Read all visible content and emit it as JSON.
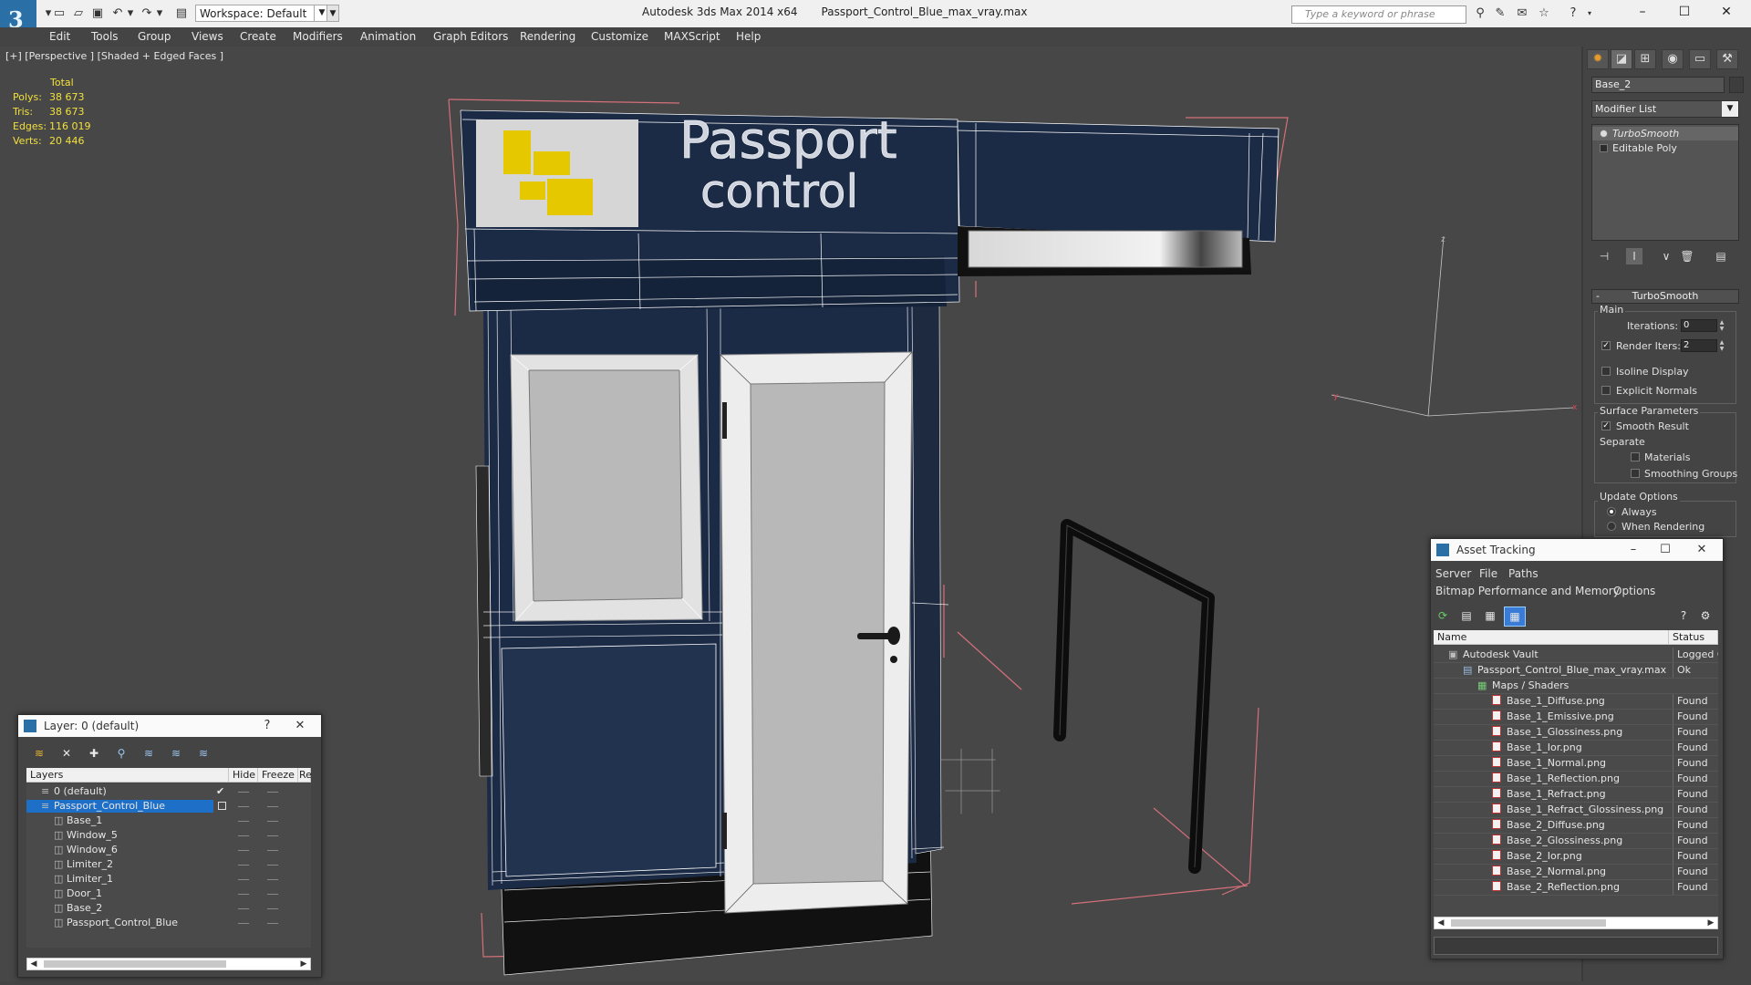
{
  "app": {
    "title": "Autodesk 3ds Max 2014 x64",
    "filename": "Passport_Control_Blue_max_vray.max",
    "workspace_label": "Workspace: Default",
    "search_placeholder": "Type a keyword or phrase"
  },
  "menus": [
    "Edit",
    "Tools",
    "Group",
    "Views",
    "Create",
    "Modifiers",
    "Animation",
    "Graph Editors",
    "Rendering",
    "Customize",
    "MAXScript",
    "Help"
  ],
  "viewport": {
    "label": "[+] [Perspective ] [Shaded + Edged Faces ]",
    "stats_header": "Total",
    "stats": [
      {
        "label": "Polys:",
        "value": "38 673"
      },
      {
        "label": "Tris:",
        "value": "38 673"
      },
      {
        "label": "Edges:",
        "value": "116 019"
      },
      {
        "label": "Verts:",
        "value": "20 446"
      }
    ],
    "sign_line1": "Passport",
    "sign_line2": "control",
    "axis_z": "z",
    "axis_y": "y",
    "axis_x": "x"
  },
  "command_panel": {
    "object_name": "Base_2",
    "modifier_list": "Modifier List",
    "stack": [
      "TurboSmooth",
      "Editable Poly"
    ],
    "rollout_title": "TurboSmooth",
    "main_group": "Main",
    "iterations_label": "Iterations:",
    "iterations_value": "0",
    "render_iters_label": "Render Iters:",
    "render_iters_value": "2",
    "isoline_label": "Isoline Display",
    "explicit_normals_label": "Explicit Normals",
    "surface_group": "Surface Parameters",
    "smooth_result_label": "Smooth Result",
    "separate_label": "Separate",
    "materials_label": "Materials",
    "smoothing_groups_label": "Smoothing Groups",
    "update_group": "Update Options",
    "always_label": "Always",
    "when_rendering_label": "When Rendering"
  },
  "layer_window": {
    "title": "Layer: 0 (default)",
    "help": "?",
    "columns": [
      "Layers",
      "Hide",
      "Freeze",
      "Re"
    ],
    "rows": [
      {
        "name": "0 (default)",
        "level": 0,
        "selected": false,
        "icon": "layer"
      },
      {
        "name": "Passport_Control_Blue",
        "level": 0,
        "selected": true,
        "icon": "layer"
      },
      {
        "name": "Base_1",
        "level": 1,
        "selected": false,
        "icon": "object"
      },
      {
        "name": "Window_5",
        "level": 1,
        "selected": false,
        "icon": "object"
      },
      {
        "name": "Window_6",
        "level": 1,
        "selected": false,
        "icon": "object"
      },
      {
        "name": "Limiter_2",
        "level": 1,
        "selected": false,
        "icon": "object"
      },
      {
        "name": "Limiter_1",
        "level": 1,
        "selected": false,
        "icon": "object"
      },
      {
        "name": "Door_1",
        "level": 1,
        "selected": false,
        "icon": "object"
      },
      {
        "name": "Base_2",
        "level": 1,
        "selected": false,
        "icon": "object"
      },
      {
        "name": "Passport_Control_Blue",
        "level": 1,
        "selected": false,
        "icon": "object"
      }
    ]
  },
  "asset_tracking": {
    "title": "Asset Tracking",
    "menu1": [
      "Server",
      "File",
      "Paths"
    ],
    "menu2": [
      "Bitmap Performance and Memory",
      "Options"
    ],
    "columns": [
      "Name",
      "Status"
    ],
    "rows": [
      {
        "name": "Autodesk Vault",
        "status": "Logged O",
        "level": 0,
        "icon": "vault"
      },
      {
        "name": "Passport_Control_Blue_max_vray.max",
        "status": "Ok",
        "level": 1,
        "icon": "max"
      },
      {
        "name": "Maps / Shaders",
        "status": "",
        "level": 2,
        "icon": "maps"
      },
      {
        "name": "Base_1_Diffuse.png",
        "status": "Found",
        "level": 3,
        "icon": "png"
      },
      {
        "name": "Base_1_Emissive.png",
        "status": "Found",
        "level": 3,
        "icon": "png"
      },
      {
        "name": "Base_1_Glossiness.png",
        "status": "Found",
        "level": 3,
        "icon": "png"
      },
      {
        "name": "Base_1_Ior.png",
        "status": "Found",
        "level": 3,
        "icon": "png"
      },
      {
        "name": "Base_1_Normal.png",
        "status": "Found",
        "level": 3,
        "icon": "png"
      },
      {
        "name": "Base_1_Reflection.png",
        "status": "Found",
        "level": 3,
        "icon": "png"
      },
      {
        "name": "Base_1_Refract.png",
        "status": "Found",
        "level": 3,
        "icon": "png"
      },
      {
        "name": "Base_1_Refract_Glossiness.png",
        "status": "Found",
        "level": 3,
        "icon": "png"
      },
      {
        "name": "Base_2_Diffuse.png",
        "status": "Found",
        "level": 3,
        "icon": "png"
      },
      {
        "name": "Base_2_Glossiness.png",
        "status": "Found",
        "level": 3,
        "icon": "png"
      },
      {
        "name": "Base_2_Ior.png",
        "status": "Found",
        "level": 3,
        "icon": "png"
      },
      {
        "name": "Base_2_Normal.png",
        "status": "Found",
        "level": 3,
        "icon": "png"
      },
      {
        "name": "Base_2_Reflection.png",
        "status": "Found",
        "level": 3,
        "icon": "png"
      }
    ]
  },
  "colors": {
    "stats_text": "#f2e03c",
    "selection": "#1e6fc8",
    "booth_blue": "#1b2a45",
    "sign_yellow": "#e5c800",
    "bbox_pink": "#d4707a"
  }
}
